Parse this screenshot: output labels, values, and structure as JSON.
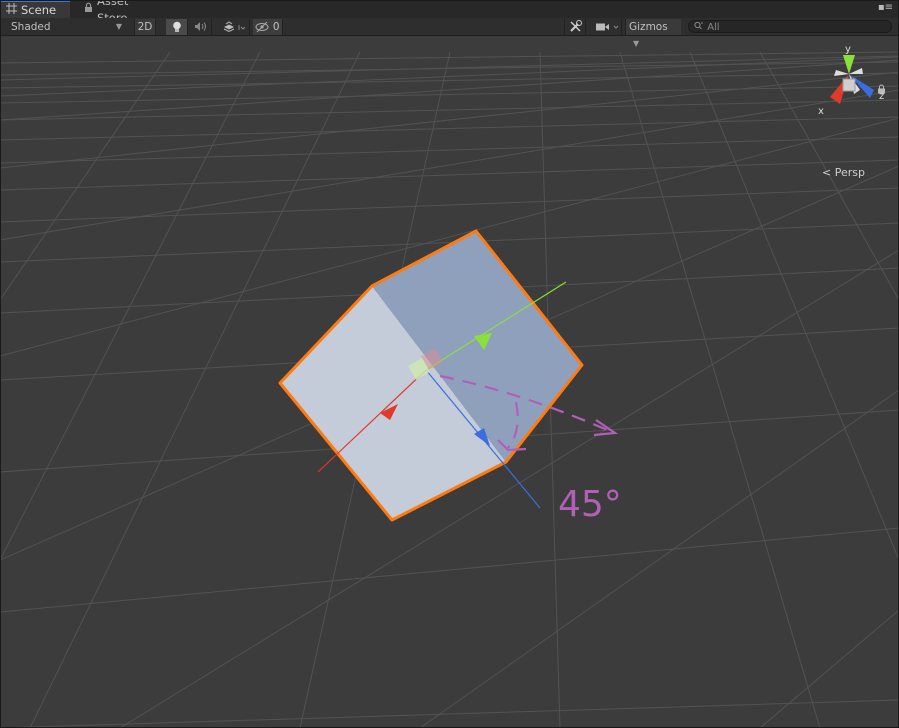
{
  "tabs": [
    {
      "label": "Scene",
      "icon": "grid-icon",
      "active": true
    },
    {
      "label": "Asset Store",
      "icon": "lock-icon",
      "active": false
    }
  ],
  "toolbar": {
    "shading_mode": "Shaded",
    "mode_2d": "2D",
    "hidden_count": "0",
    "gizmos_label": "Gizmos",
    "search_placeholder": "All"
  },
  "view": {
    "projection": "Persp",
    "axes": {
      "x": "x",
      "y": "y",
      "z": "z"
    }
  },
  "annotation": {
    "rotation_text": "45°"
  },
  "colors": {
    "grid_background": "#3c3c3c",
    "selection_outline": "#ff7a10",
    "x_axis": "#e03a2a",
    "y_axis": "#8ae03a",
    "z_axis": "#3a6ee0",
    "annotation": "#b25fb8"
  }
}
